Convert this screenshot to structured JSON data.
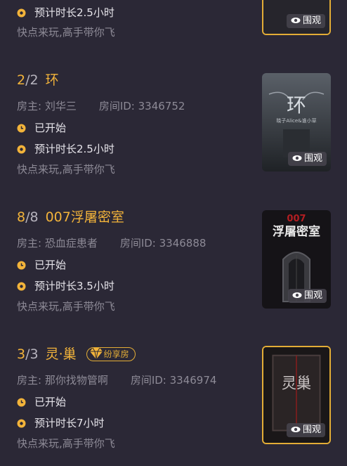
{
  "rooms": [
    {
      "duration": "预计时长2.5小时",
      "tagline": "快点来玩,高手带你飞",
      "watch": "围观"
    },
    {
      "count_current": "2",
      "count_sep": "/",
      "count_total": "2",
      "name": "环",
      "host": "房主: 刘华三",
      "room_id": "房间ID: 3346752",
      "status": "已开始",
      "duration": "预计时长2.5小时",
      "tagline": "快点来玩,高手带你飞",
      "watch": "围观",
      "poster_title": "环",
      "poster_sub": "晓子Alice&谁小草"
    },
    {
      "count_current": "8",
      "count_sep": "/",
      "count_total": "8",
      "name": "007浮屠密室",
      "host": "房主: 恐血症患者",
      "room_id": "房间ID: 3346888",
      "status": "已开始",
      "duration": "预计时长3.5小时",
      "tagline": "快点来玩,高手带你飞",
      "watch": "围观",
      "poster_title": "007",
      "poster_sub": "浮屠密室"
    },
    {
      "count_current": "3",
      "count_sep": "/",
      "count_total": "3",
      "name": "灵·巢",
      "badge": "纷享房",
      "host": "房主: 那你找物管啊",
      "room_id": "房间ID: 3346974",
      "status": "已开始",
      "duration": "预计时长7小时",
      "tagline": "快点来玩,高手带你飞",
      "watch": "围观",
      "poster_title": "灵巢"
    }
  ],
  "colors": {
    "accent": "#f2b33a",
    "background": "#2b2836",
    "muted": "#8d8a96",
    "gold_border": "#e3ad36"
  }
}
